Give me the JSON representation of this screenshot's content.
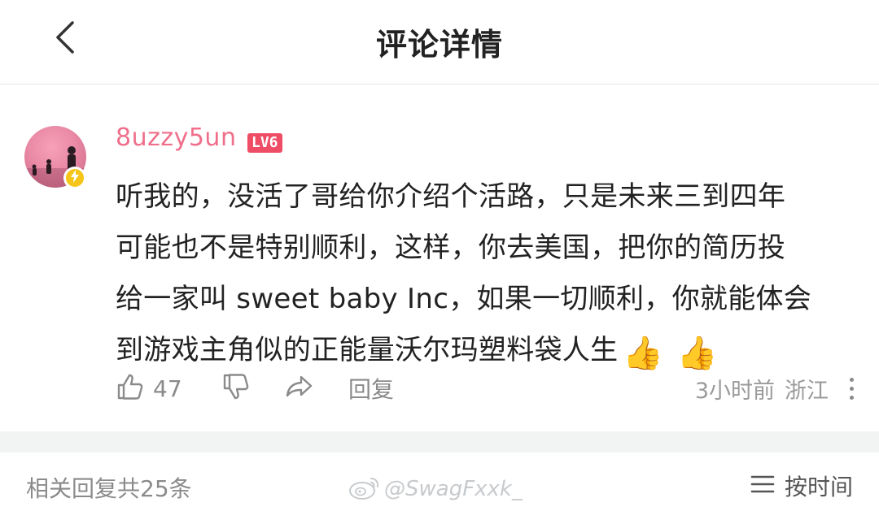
{
  "header": {
    "title": "评论详情",
    "back_icon": "chevron-left-icon"
  },
  "comment": {
    "username": "8uzzy5un",
    "level": "LV6",
    "lines": [
      "听我的，没活了哥给你介绍个活路，只是未来三到四年",
      "可能也不是特别顺利，这样，你去美国，把你的简历投",
      "给一家叫 sweet baby Inc，如果一切顺利，你就能体会",
      "到游戏主角似的正能量沃尔玛塑料袋人生"
    ],
    "emojis": [
      "👍",
      "👍"
    ],
    "likes": "47",
    "reply_label": "回复",
    "time": "3小时前",
    "location": "浙江"
  },
  "footer": {
    "reply_count": "相关回复共25条",
    "watermark": "@SwagFxxk_",
    "sort_label": "按时间"
  },
  "colors": {
    "username": "#ef6f8b",
    "level_badge": "#ee4d65",
    "separator": "#f2f4f4"
  }
}
